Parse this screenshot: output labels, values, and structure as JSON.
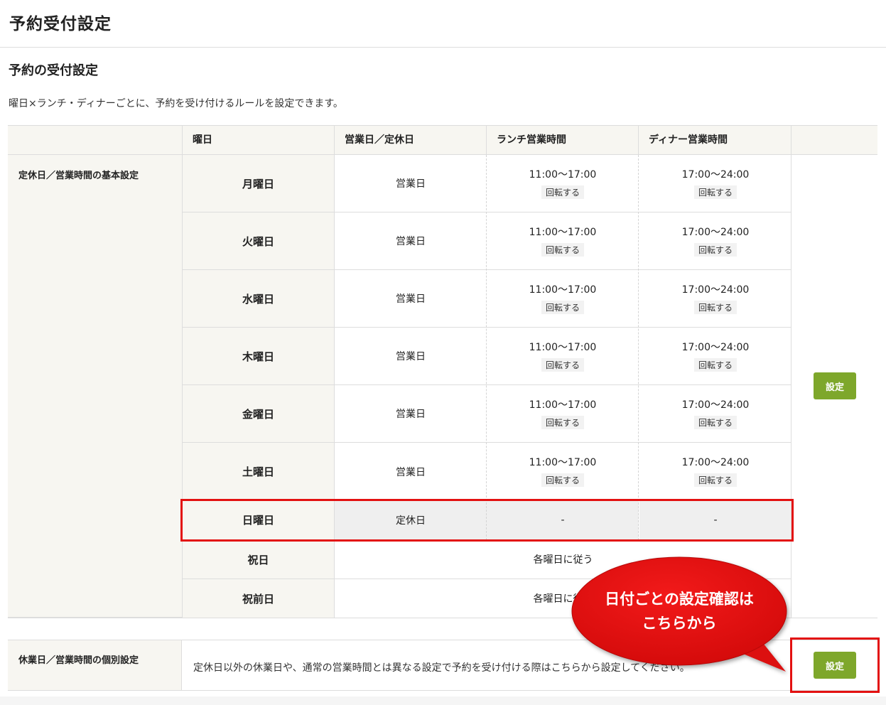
{
  "page_title": "予約受付設定",
  "section_title": "予約の受付設定",
  "description": "曜日×ランチ・ディナーごとに、予約を受け付けるルールを設定できます。",
  "table": {
    "headers": [
      "曜日",
      "営業日／定休日",
      "ランチ営業時間",
      "ディナー営業時間"
    ],
    "basic_label": "定休日／営業時間の基本設定",
    "rows": [
      {
        "day": "月曜日",
        "status": "営業日",
        "lunch": "11:00〜17:00",
        "lunch_note": "回転する",
        "dinner": "17:00〜24:00",
        "dinner_note": "回転する"
      },
      {
        "day": "火曜日",
        "status": "営業日",
        "lunch": "11:00〜17:00",
        "lunch_note": "回転する",
        "dinner": "17:00〜24:00",
        "dinner_note": "回転する"
      },
      {
        "day": "水曜日",
        "status": "営業日",
        "lunch": "11:00〜17:00",
        "lunch_note": "回転する",
        "dinner": "17:00〜24:00",
        "dinner_note": "回転する"
      },
      {
        "day": "木曜日",
        "status": "営業日",
        "lunch": "11:00〜17:00",
        "lunch_note": "回転する",
        "dinner": "17:00〜24:00",
        "dinner_note": "回転する"
      },
      {
        "day": "金曜日",
        "status": "営業日",
        "lunch": "11:00〜17:00",
        "lunch_note": "回転する",
        "dinner": "17:00〜24:00",
        "dinner_note": "回転する"
      },
      {
        "day": "土曜日",
        "status": "営業日",
        "lunch": "11:00〜17:00",
        "lunch_note": "回転する",
        "dinner": "17:00〜24:00",
        "dinner_note": "回転する"
      }
    ],
    "sunday": {
      "day": "日曜日",
      "status": "定休日",
      "lunch": "-",
      "dinner": "-"
    },
    "holiday": {
      "day": "祝日",
      "value": "各曜日に従う"
    },
    "pre_holiday": {
      "day": "祝前日",
      "value": "各曜日に従う"
    },
    "set_button": "設定"
  },
  "individual": {
    "label": "休業日／営業時間の個別設定",
    "text": "定休日以外の休業日や、通常の営業時間とは異なる設定で予約を受け付ける際はこちらから設定してください。",
    "set_button": "設定"
  },
  "callout": {
    "line1": "日付ごとの設定確認は",
    "line2": "こちらから"
  },
  "colors": {
    "accent_button": "#7ea72b",
    "highlight": "#e31111",
    "callout_fill": "#e20f0f"
  }
}
